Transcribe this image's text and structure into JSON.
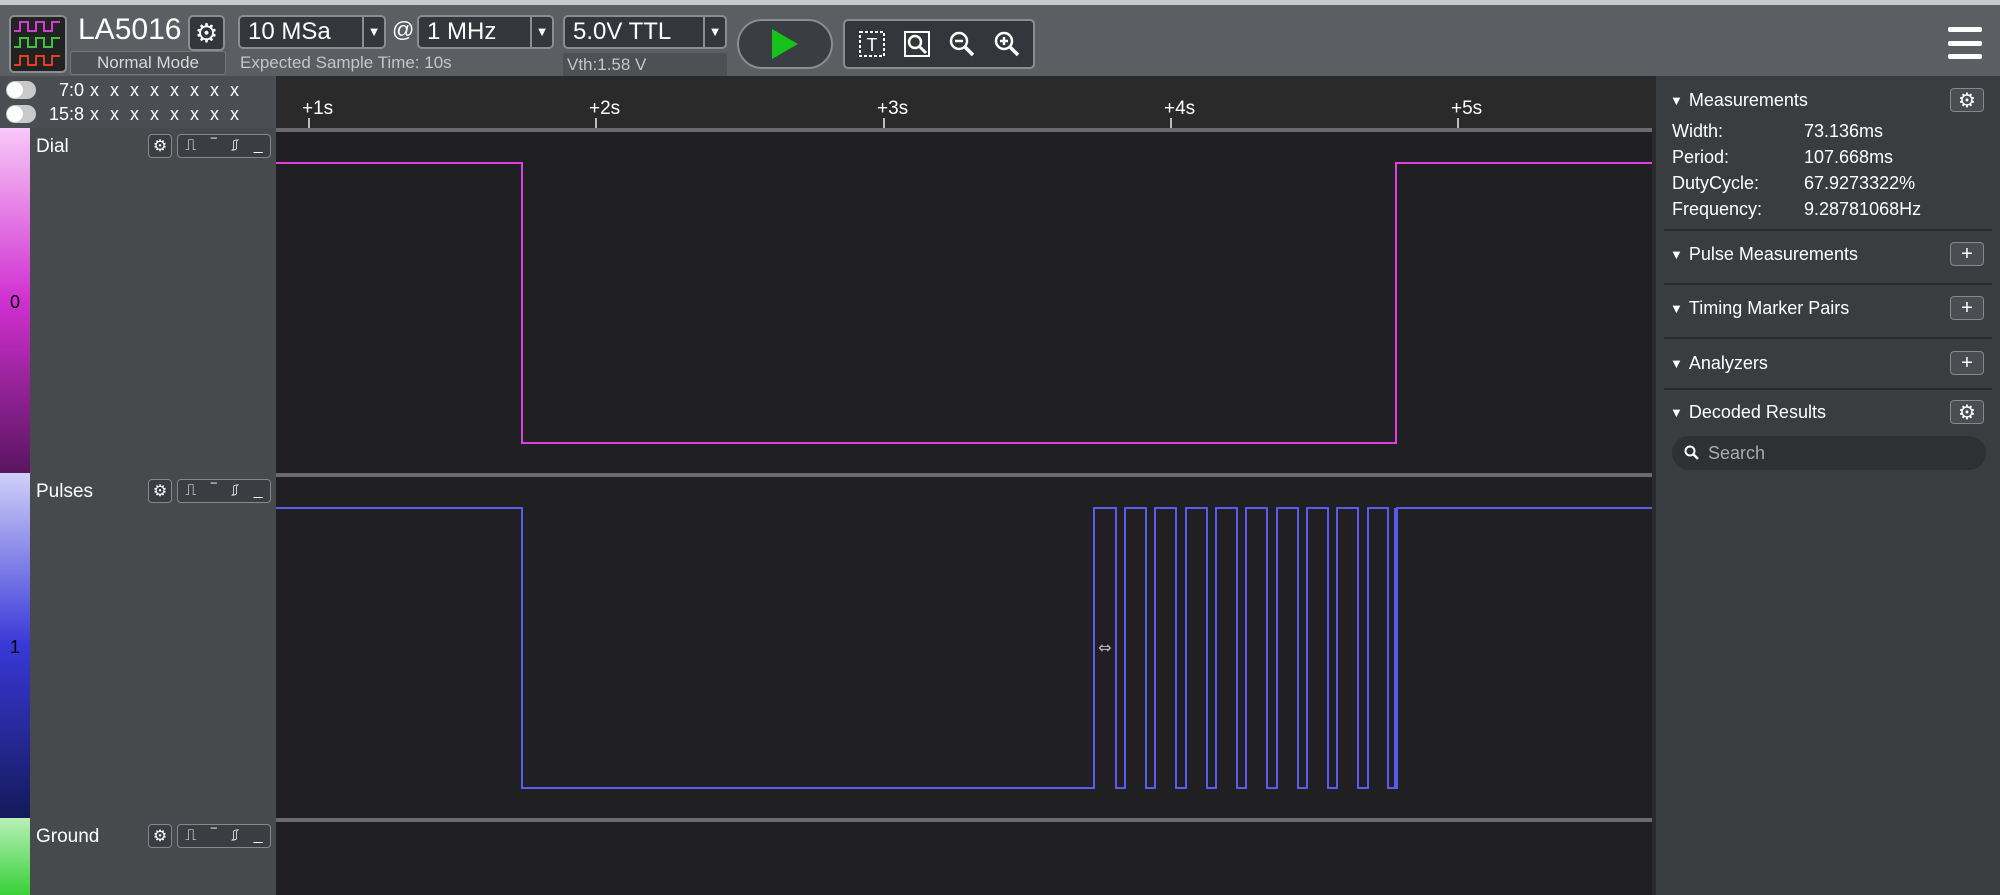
{
  "toolbar": {
    "device_name": "LA5016",
    "mode": "Normal Mode",
    "sample_depth": "10 MSa",
    "at_sign": "@",
    "sample_rate": "1 MHz",
    "expected_time": "Expected Sample Time: 10s",
    "threshold": "5.0V TTL",
    "vth": "Vth:1.58 V"
  },
  "bits": [
    {
      "label": "7:0",
      "values": "x x x x x x x x"
    },
    {
      "label": "15:8",
      "values": "x x x x x x x x"
    }
  ],
  "ruler": {
    "ticks": [
      "+1s",
      "+2s",
      "+3s",
      "+4s",
      "+5s"
    ]
  },
  "channels": [
    {
      "name": "Dial",
      "index": "0",
      "color": "#e040e0"
    },
    {
      "name": "Pulses",
      "index": "1",
      "color": "#5050ee"
    },
    {
      "name": "Ground",
      "index": "",
      "color": "#44dd44"
    }
  ],
  "panel": {
    "measurements_title": "Measurements",
    "measurements": [
      {
        "k": "Width:",
        "v": "73.136ms"
      },
      {
        "k": "Period:",
        "v": "107.668ms"
      },
      {
        "k": "DutyCycle:",
        "v": "67.9273322%"
      },
      {
        "k": "Frequency:",
        "v": "9.28781068Hz"
      }
    ],
    "pulse_measurements": "Pulse Measurements",
    "timing_marker_pairs": "Timing Marker Pairs",
    "analyzers": "Analyzers",
    "decoded_results": "Decoded Results",
    "search_placeholder": "Search"
  },
  "colors": {
    "dial_wave": "#e040e0",
    "pulses_wave": "#5050ee",
    "run": "#16c21b"
  },
  "icons": [
    "logic-analyzer-icon",
    "gear-icon",
    "play-icon",
    "text-tool-icon",
    "zoom-fit-icon",
    "zoom-out-icon",
    "zoom-in-icon",
    "hamburger-menu-icon",
    "search-icon"
  ]
}
